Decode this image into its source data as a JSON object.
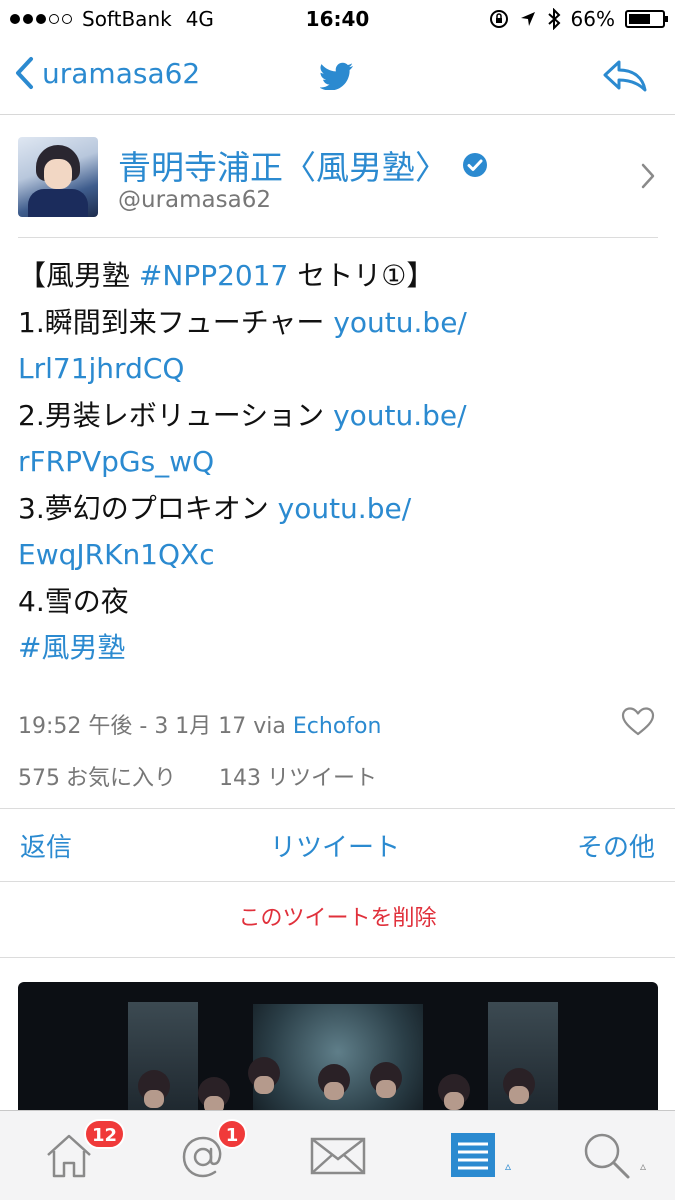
{
  "status_bar": {
    "carrier": "SoftBank",
    "network": "4G",
    "time": "16:40",
    "battery": "66%",
    "battery_level": 0.66
  },
  "nav": {
    "back_label": "uramasa62",
    "center_icon": "twitter-bird-icon",
    "right_icon": "reply-icon"
  },
  "profile": {
    "display_name": "青明寺浦正〈風男塾〉",
    "handle": "@uramasa62",
    "verified": true
  },
  "tweet": {
    "line1_pre": "【風男塾 ",
    "line1_tag": "#NPP2017",
    "line1_post": " セトリ①】",
    "items": [
      {
        "title": "1.瞬間到来フューチャー ",
        "link_a": "youtu.be/",
        "link_b": "Lrl71jhrdCQ"
      },
      {
        "title": "2.男装レボリューション ",
        "link_a": "youtu.be/",
        "link_b": "rFRPVpGs_wQ"
      },
      {
        "title": "3.夢幻のプロキオン ",
        "link_a": "youtu.be/",
        "link_b": "EwqJRKn1QXc"
      }
    ],
    "item4": "4.雪の夜",
    "hashtag": "#風男塾"
  },
  "meta": {
    "datetime": "19:52 午後 - 3 1月 17 via ",
    "client": "Echofon"
  },
  "stats": {
    "favorites_count": "575",
    "favorites_label": "お気に入り",
    "retweets_count": "143",
    "retweets_label": "リツイート"
  },
  "actions": {
    "reply": "返信",
    "retweet": "リツイート",
    "more": "その他"
  },
  "delete_label": "このツイートを削除",
  "tabbar": {
    "home_badge": "12",
    "mentions_badge": "1"
  },
  "colors": {
    "accent": "#2b8ad0",
    "danger": "#e0303b",
    "badge": "#f03a3a"
  }
}
